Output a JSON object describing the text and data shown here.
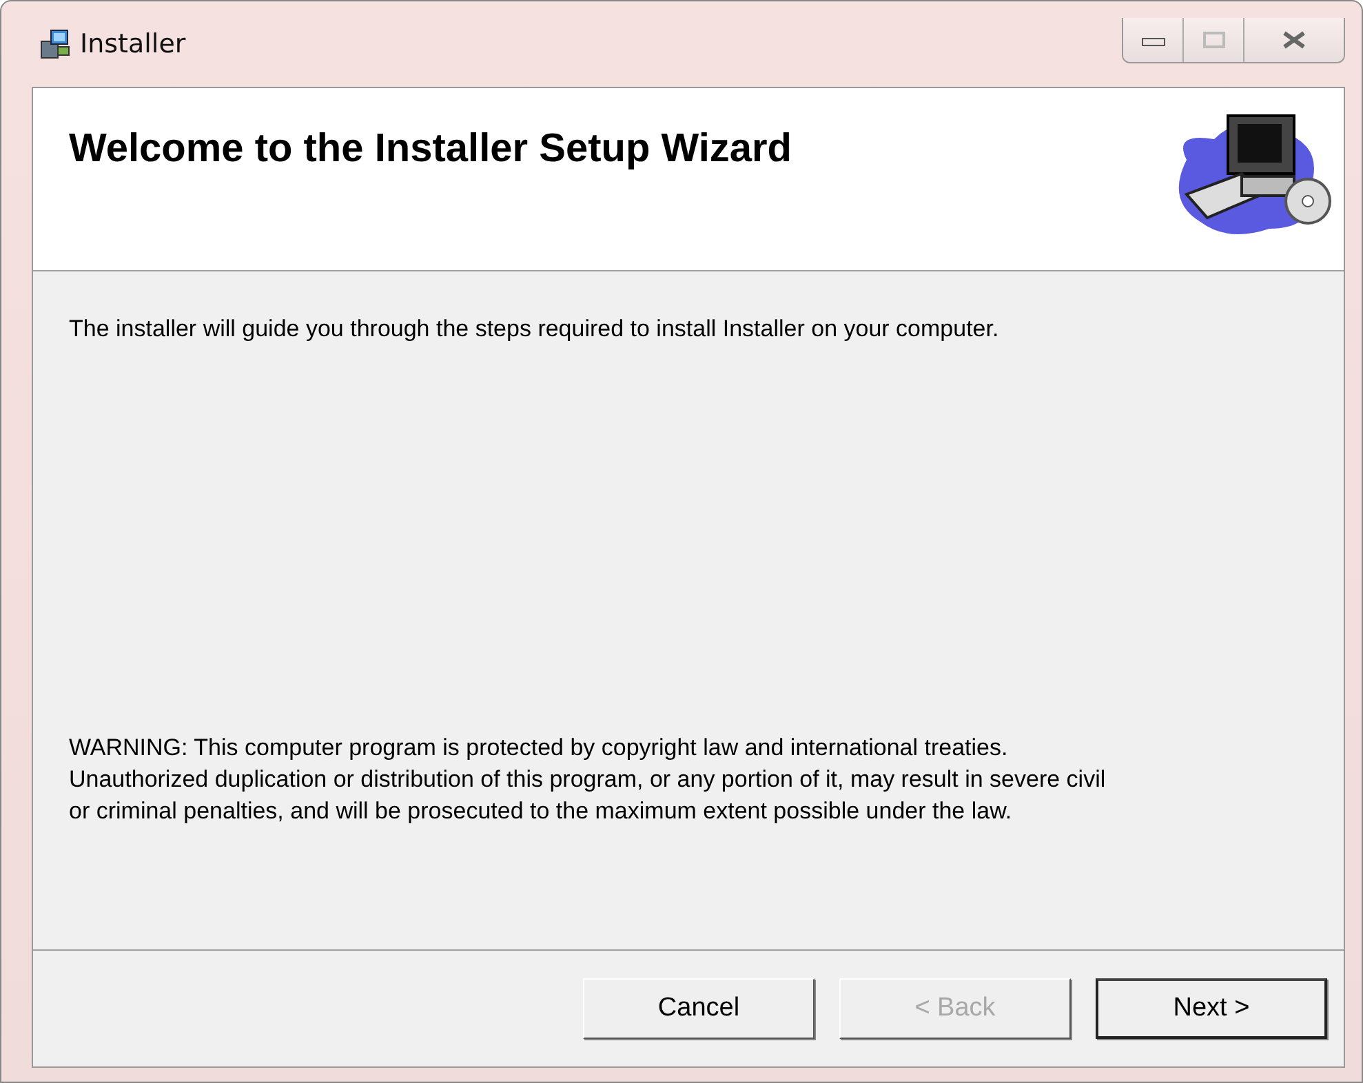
{
  "window": {
    "title": "Installer"
  },
  "header": {
    "title": "Welcome to the Installer Setup Wizard"
  },
  "body": {
    "intro": "The installer will guide you through the steps required to install Installer on your computer.",
    "warning": "WARNING: This computer program is protected by copyright law and international treaties. Unauthorized duplication or distribution of this program, or any portion of it, may result in severe civil or criminal penalties, and will be prosecuted to the maximum extent possible under the law."
  },
  "buttons": [
    {
      "label": "Cancel",
      "disabled": false,
      "default": false
    },
    {
      "label": "< Back",
      "disabled": true,
      "default": false
    },
    {
      "label": "Next >",
      "disabled": false,
      "default": true
    }
  ]
}
